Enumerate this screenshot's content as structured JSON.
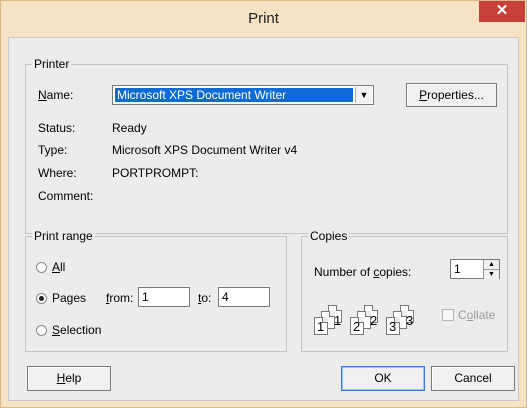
{
  "window": {
    "title": "Print",
    "close_glyph": "✕"
  },
  "printer": {
    "group_title": "Printer",
    "name_label": "Name:",
    "name_value": "Microsoft XPS Document Writer",
    "properties_label": "Properties...",
    "status_label": "Status:",
    "status_value": "Ready",
    "type_label": "Type:",
    "type_value": "Microsoft XPS Document Writer v4",
    "where_label": "Where:",
    "where_value": "PORTPROMPT:",
    "comment_label": "Comment:"
  },
  "print_range": {
    "group_title": "Print range",
    "all_label": "All",
    "pages_label": "Pages",
    "from_label": "from:",
    "from_value": "1",
    "to_label": "to:",
    "to_value": "4",
    "selection_label": "Selection",
    "selected": "pages"
  },
  "copies": {
    "group_title": "Copies",
    "number_label": "Number of copies:",
    "number_value": "1",
    "collate_label": "Collate",
    "collate_checked": false,
    "collate_icon_digits": [
      "1",
      "1",
      "2",
      "2",
      "3",
      "3"
    ]
  },
  "buttons": {
    "help": "Help",
    "ok": "OK",
    "cancel": "Cancel"
  },
  "colors": {
    "titlebar": "#f6e3c3",
    "close": "#c7403a",
    "selection": "#0e6ad4",
    "dialog": "#ececec"
  }
}
